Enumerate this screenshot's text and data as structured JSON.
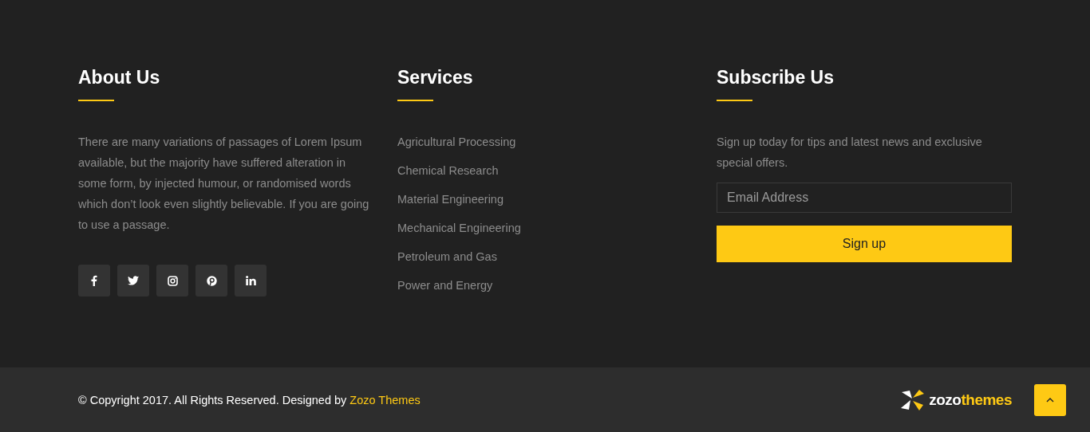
{
  "about": {
    "title": "About Us",
    "text": "There are many variations of passages of Lorem Ipsum available, but the majority have suffered alteration in some form, by injected humour, or randomised words which don’t look even slightly believable. If you are going to use a passage.",
    "social": [
      {
        "kind": "facebook"
      },
      {
        "kind": "twitter"
      },
      {
        "kind": "instagram"
      },
      {
        "kind": "pinterest"
      },
      {
        "kind": "linkedin"
      }
    ]
  },
  "services": {
    "title": "Services",
    "items": [
      "Agricultural Processing",
      "Chemical Research",
      "Material Engineering",
      "Mechanical Engineering",
      "Petroleum and Gas",
      "Power and Energy"
    ]
  },
  "subscribe": {
    "title": "Subscribe Us",
    "text": "Sign up today for tips and latest news and exclusive special offers.",
    "placeholder": "Email Address",
    "button": "Sign up"
  },
  "bottom": {
    "copyright": "© Copyright 2017. All Rights Reserved. Designed by ",
    "link": "Zozo Themes",
    "logo_main": "zozo",
    "logo_accent": "themes"
  }
}
